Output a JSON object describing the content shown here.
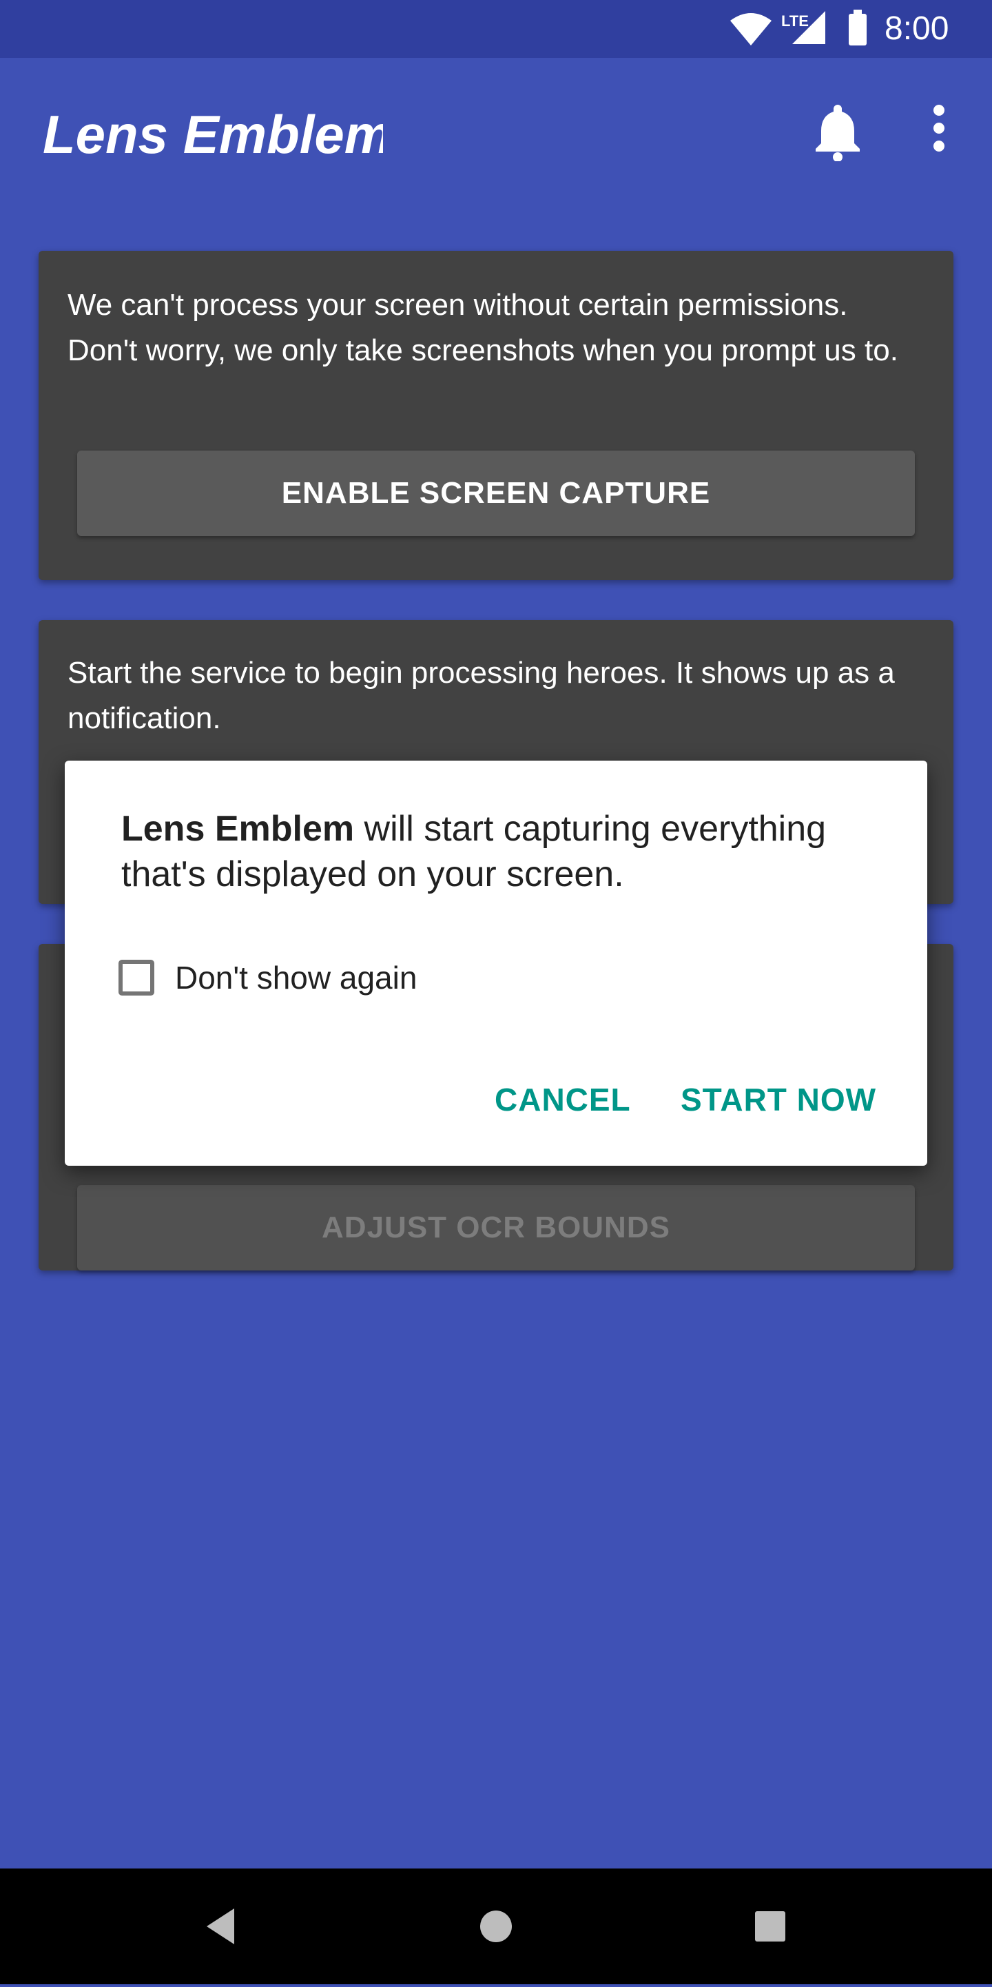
{
  "status_bar": {
    "time": "8:00",
    "network_label": "LTE",
    "icons": [
      "wifi-icon",
      "lte-signal-icon",
      "battery-icon"
    ]
  },
  "app_bar": {
    "title": "Lens Emblem",
    "actions": [
      "bell-icon",
      "more-vert-icon"
    ]
  },
  "cards": [
    {
      "text": "We can't process your screen without certain permissions. Don't worry, we only take screenshots when you prompt us to.",
      "button": "ENABLE SCREEN CAPTURE"
    },
    {
      "text": "Start the service to begin processing heroes. It shows up as a notification."
    },
    {
      "button": "ADJUST OCR BOUNDS"
    }
  ],
  "dialog": {
    "app_name": "Lens Emblem",
    "message_rest": " will start capturing everything that's displayed on your screen.",
    "checkbox_label": "Don't show again",
    "checkbox_checked": false,
    "cancel": "CANCEL",
    "confirm": "START NOW"
  },
  "nav_bar": {
    "icons": [
      "back-icon",
      "home-icon",
      "recents-icon"
    ]
  },
  "colors": {
    "primary": "#3f51b5",
    "primary_dark": "#303f9f",
    "card": "#424242",
    "accent": "#009688"
  }
}
